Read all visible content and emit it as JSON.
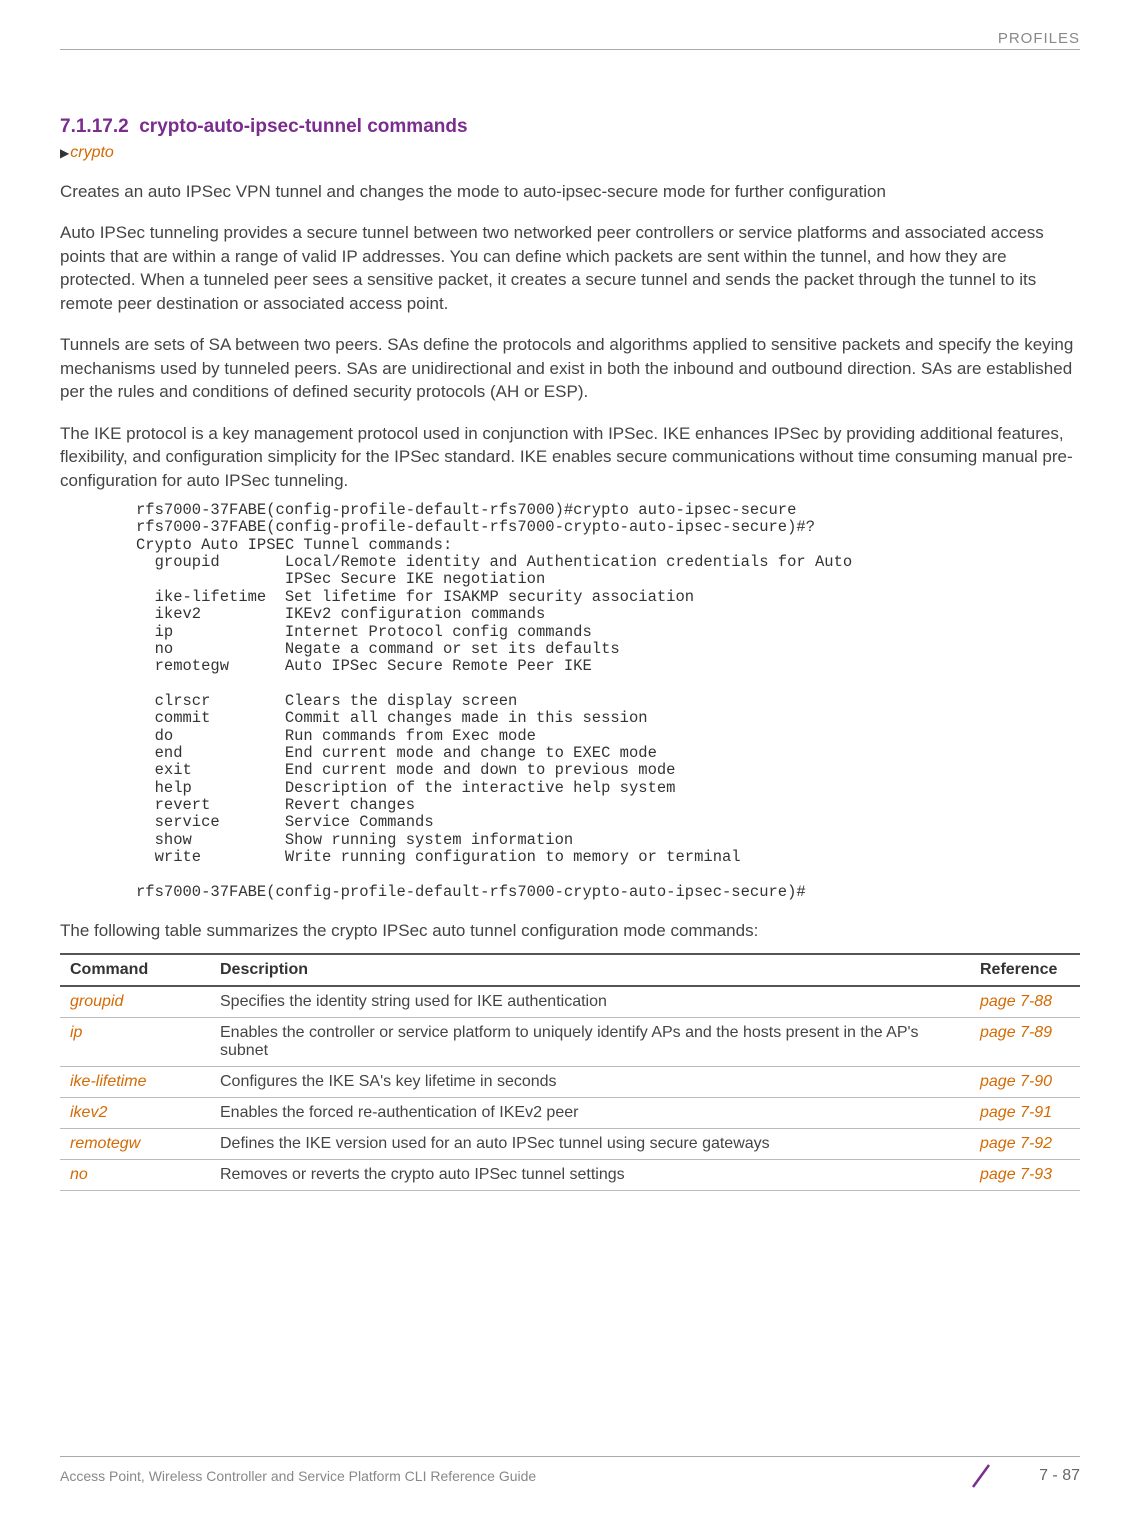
{
  "header": {
    "label": "PROFILES"
  },
  "section": {
    "number": "7.1.17.2",
    "title": "crypto-auto-ipsec-tunnel commands",
    "crypto_link": "crypto"
  },
  "paragraphs": {
    "p1": "Creates an auto IPSec VPN tunnel and changes the mode to auto-ipsec-secure mode for further configuration",
    "p2": "Auto IPSec tunneling provides a secure tunnel between two networked peer controllers or service platforms and associated access points that are within a range of valid IP addresses. You can define which packets are sent within the tunnel, and how they are protected. When a tunneled peer sees a sensitive packet, it creates a secure tunnel and sends the packet through the tunnel to its remote peer destination or associated access point.",
    "p3": "Tunnels are sets of SA between two peers. SAs define the protocols and algorithms applied to sensitive packets and specify the keying mechanisms used by tunneled peers. SAs are unidirectional and exist in both the inbound and outbound direction. SAs are established per the rules and conditions of defined security protocols (AH or ESP).",
    "p4": "The IKE protocol is a key management protocol used in conjunction with IPSec. IKE enhances IPSec by providing additional features, flexibility, and configuration simplicity for the IPSec standard. IKE enables secure communications without time consuming manual pre-configuration for auto IPSec tunneling."
  },
  "code_block": "rfs7000-37FABE(config-profile-default-rfs7000)#crypto auto-ipsec-secure\nrfs7000-37FABE(config-profile-default-rfs7000-crypto-auto-ipsec-secure)#?\nCrypto Auto IPSEC Tunnel commands:\n  groupid       Local/Remote identity and Authentication credentials for Auto\n                IPSec Secure IKE negotiation\n  ike-lifetime  Set lifetime for ISAKMP security association\n  ikev2         IKEv2 configuration commands\n  ip            Internet Protocol config commands\n  no            Negate a command or set its defaults\n  remotegw      Auto IPSec Secure Remote Peer IKE\n\n  clrscr        Clears the display screen\n  commit        Commit all changes made in this session\n  do            Run commands from Exec mode\n  end           End current mode and change to EXEC mode\n  exit          End current mode and down to previous mode\n  help          Description of the interactive help system\n  revert        Revert changes\n  service       Service Commands\n  show          Show running system information\n  write         Write running configuration to memory or terminal\n\nrfs7000-37FABE(config-profile-default-rfs7000-crypto-auto-ipsec-secure)#",
  "summary_line": "The following table summarizes the crypto IPSec auto tunnel configuration mode commands:",
  "table": {
    "headers": {
      "c1": "Command",
      "c2": "Description",
      "c3": "Reference"
    },
    "rows": [
      {
        "cmd": "groupid",
        "desc": "Specifies the identity string used for IKE authentication",
        "ref": "page 7-88"
      },
      {
        "cmd": "ip",
        "desc": "Enables the controller or service platform to uniquely identify APs and the hosts present in the AP's subnet",
        "ref": "page 7-89"
      },
      {
        "cmd": "ike-lifetime",
        "desc": "Configures the IKE SA's key lifetime in seconds",
        "ref": "page 7-90"
      },
      {
        "cmd": "ikev2",
        "desc": "Enables the forced re-authentication of IKEv2 peer",
        "ref": "page 7-91"
      },
      {
        "cmd": "remotegw",
        "desc": "Defines the IKE version used for an auto IPSec tunnel using secure gateways",
        "ref": "page 7-92"
      },
      {
        "cmd": "no",
        "desc": "Removes or reverts the crypto auto IPSec tunnel settings",
        "ref": "page 7-93"
      }
    ]
  },
  "footer": {
    "text": "Access Point, Wireless Controller and Service Platform CLI Reference Guide",
    "page": "7 - 87"
  }
}
